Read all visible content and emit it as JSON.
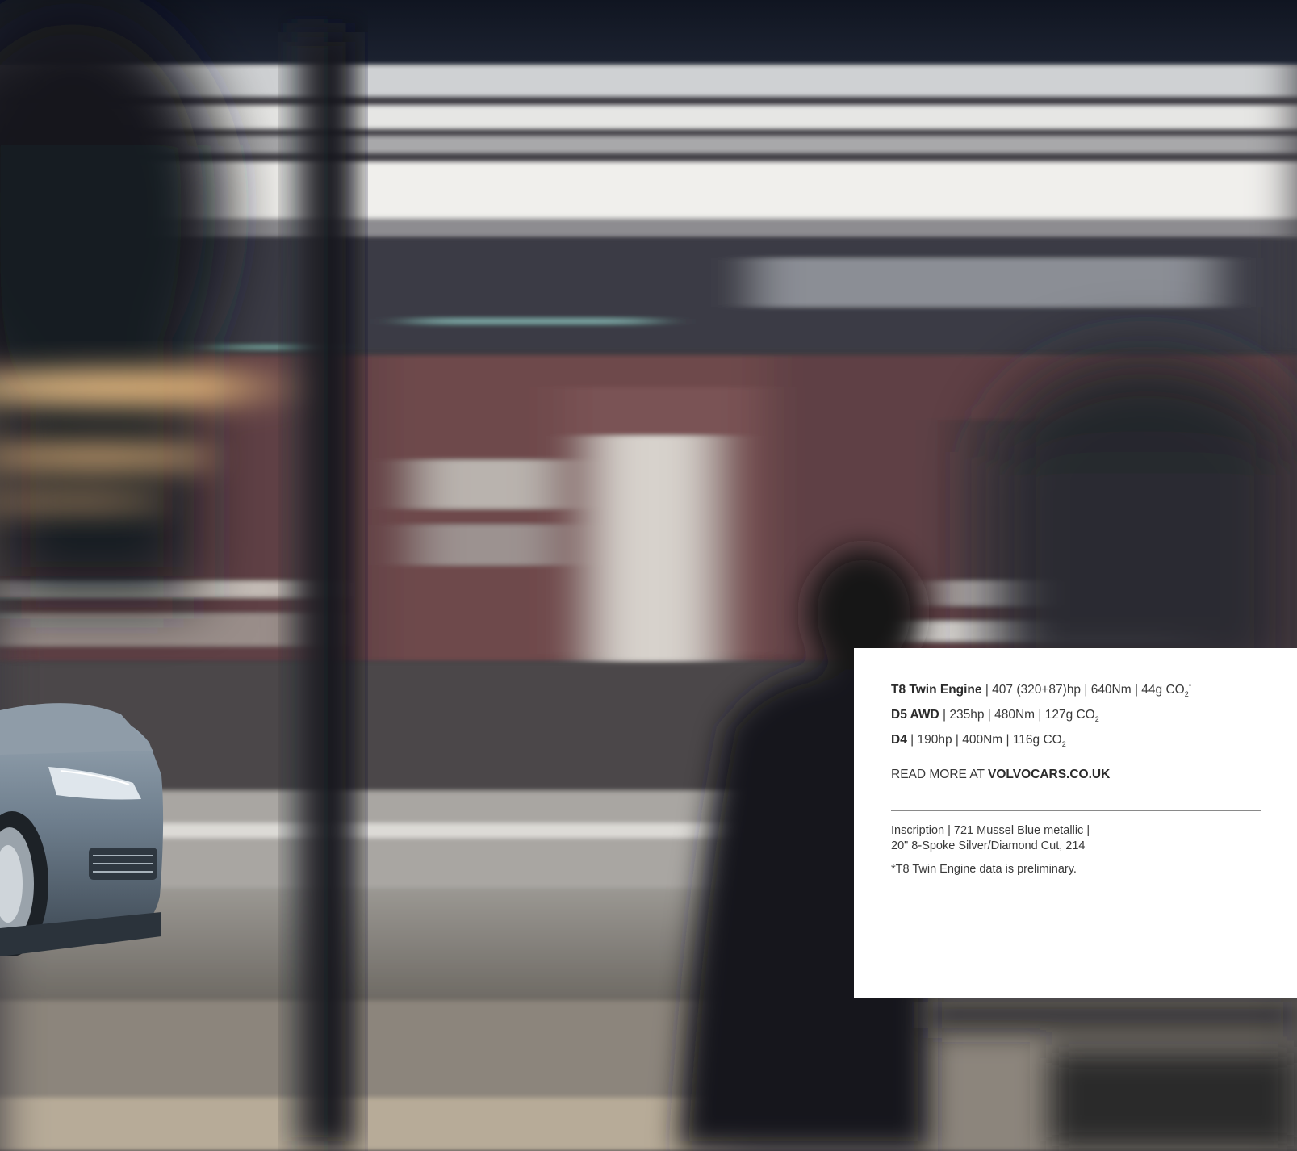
{
  "specs": [
    {
      "model": "T8 Twin Engine",
      "details": " | 407 (320+87)hp | 640Nm | 44g CO",
      "sub": "2",
      "sup": "*"
    },
    {
      "model": "D5 AWD",
      "details": " | 235hp | 480Nm | 127g CO",
      "sub": "2",
      "sup": ""
    },
    {
      "model": "D4",
      "details": " | 190hp | 400Nm | 116g CO",
      "sub": "2",
      "sup": ""
    }
  ],
  "read_more": {
    "prefix": "READ MORE AT ",
    "site": "VOLVOCARS.CO.UK"
  },
  "caption": {
    "line1": "Inscription | 721 Mussel Blue metallic |",
    "line2": "20\" 8-Spoke Silver/Diamond Cut, 214"
  },
  "footnote": "*T8 Twin Engine data is preliminary.",
  "colors": {
    "panel_bg": "#ffffff",
    "text": "#3a3a3a",
    "car_paint": "#6f7f8e"
  }
}
